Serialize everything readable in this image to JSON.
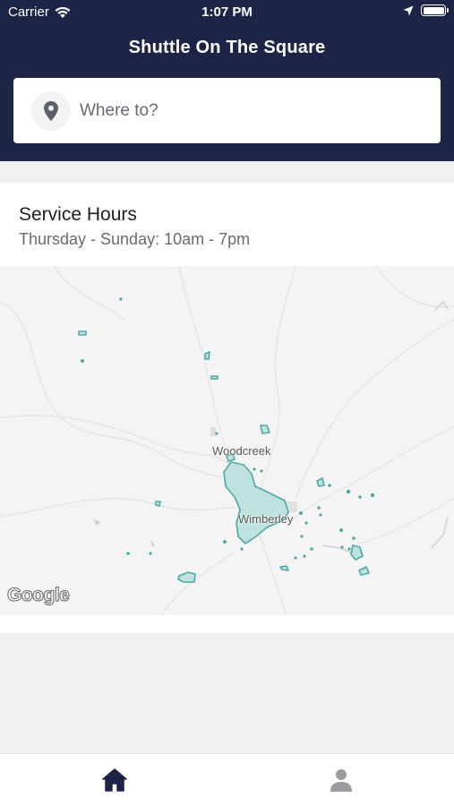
{
  "status": {
    "carrier": "Carrier",
    "time": "1:07 PM"
  },
  "header": {
    "title": "Shuttle On The Square"
  },
  "search": {
    "placeholder": "Where to?",
    "icon": "location-pin-icon"
  },
  "hours": {
    "title": "Service Hours",
    "detail": "Thursday - Sunday: 10am - 7pm"
  },
  "map": {
    "labels": {
      "woodcreek": "Woodcreek",
      "wimberley": "Wimberley"
    },
    "attribution": "Google",
    "zone_color": "#4ea8a8"
  },
  "tabs": [
    {
      "name": "home",
      "icon": "home-icon",
      "active": true
    },
    {
      "name": "profile",
      "icon": "person-icon",
      "active": false
    }
  ],
  "colors": {
    "header_bg": "#1d2446",
    "tab_active": "#1d2446",
    "tab_inactive": "#9b9ba1"
  }
}
